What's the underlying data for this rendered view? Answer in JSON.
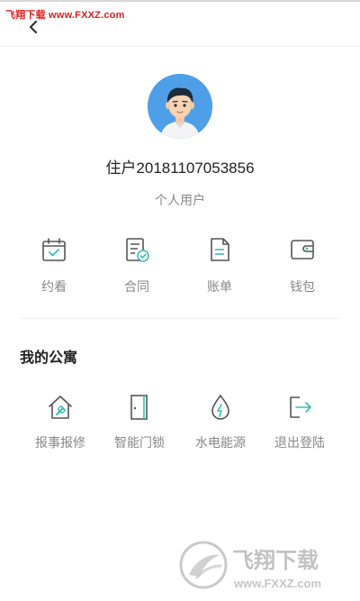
{
  "watermark": {
    "top_text": "飞翔下载 www.FXXZ.com",
    "logo_title": "飞翔下载",
    "logo_url": "www.FXXZ.com"
  },
  "header": {
    "back_icon": "chevron-left-icon"
  },
  "profile": {
    "name": "住户20181107053856",
    "type": "个人用户"
  },
  "quick_actions": [
    {
      "label": "约看",
      "icon": "calendar-check-icon"
    },
    {
      "label": "合同",
      "icon": "contract-check-icon"
    },
    {
      "label": "账单",
      "icon": "bill-icon"
    },
    {
      "label": "钱包",
      "icon": "wallet-icon"
    }
  ],
  "apartment": {
    "title": "我的公寓",
    "items": [
      {
        "label": "报事报修",
        "icon": "house-repair-icon"
      },
      {
        "label": "智能门锁",
        "icon": "door-icon"
      },
      {
        "label": "水电能源",
        "icon": "water-energy-icon"
      },
      {
        "label": "退出登陆",
        "icon": "logout-icon"
      }
    ]
  },
  "colors": {
    "accent": "#3dbdb0",
    "icon_gray": "#555555",
    "avatar_bg": "#4f9ee8"
  }
}
